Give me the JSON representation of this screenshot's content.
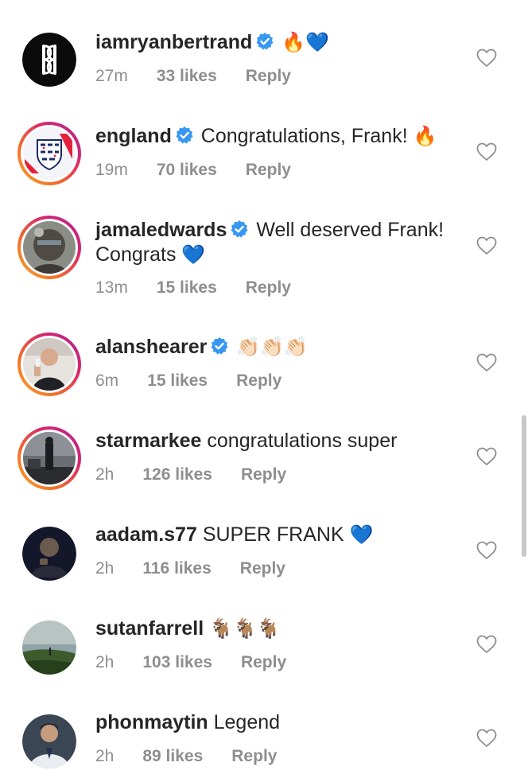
{
  "comments": [
    {
      "username": "iamryanbertrand",
      "verified": true,
      "text": "",
      "emoji": "🔥💙",
      "time": "27m",
      "likes": "33 likes",
      "reply": "Reply"
    },
    {
      "username": "england",
      "verified": true,
      "text": "Congratulations, Frank!",
      "emoji": "🔥",
      "time": "19m",
      "likes": "70 likes",
      "reply": "Reply"
    },
    {
      "username": "jamaledwards",
      "verified": true,
      "text": "Well deserved Frank! Congrats",
      "emoji": "💙",
      "time": "13m",
      "likes": "15 likes",
      "reply": "Reply"
    },
    {
      "username": "alanshearer",
      "verified": true,
      "text": "",
      "emoji": "👏🏻👏🏻👏🏻",
      "time": "6m",
      "likes": "15 likes",
      "reply": "Reply"
    },
    {
      "username": "starmarkee",
      "verified": false,
      "text": "congratulations super",
      "emoji": "",
      "time": "2h",
      "likes": "126 likes",
      "reply": "Reply"
    },
    {
      "username": "aadam.s77",
      "verified": false,
      "text": "SUPER FRANK",
      "emoji": "💙",
      "time": "2h",
      "likes": "116 likes",
      "reply": "Reply"
    },
    {
      "username": "sutanfarrell",
      "verified": false,
      "text": "",
      "emoji": "🐐🐐🐐",
      "time": "2h",
      "likes": "103 likes",
      "reply": "Reply"
    },
    {
      "username": "phonmaytin",
      "verified": false,
      "text": "Legend",
      "emoji": "",
      "time": "2h",
      "likes": "89 likes",
      "reply": "Reply"
    }
  ],
  "colors": {
    "verified": "#3897f0",
    "meta": "#8e8e8e",
    "text": "#262626",
    "heart_blue": "#2f80ed"
  },
  "icons": {
    "like": "heart-outline-icon",
    "verified": "verified-badge-icon"
  }
}
